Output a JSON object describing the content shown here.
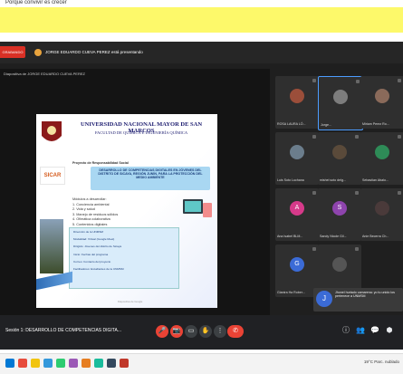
{
  "banner": {
    "text": "Porque convivir es crecer"
  },
  "presentation": {
    "rec_label": "GRABANDO",
    "presenter_text": "JORGE EDUARDO CUEVA PEREZ está presentando",
    "slide_header": "Diapositiva de JORGE EDUARDO CUEVA PEREZ",
    "slide": {
      "university": "UNIVERSIDAD NACIONAL MAYOR DE SAN MARCOS",
      "faculty": "FACULTAD DE QUÍMICA E INGENIERÍA QUÍMICA",
      "logo_text": "SICAR",
      "project_label": "Proyecto de Responsabilidad Social",
      "project_title": "DESARROLLO DE COMPETENCIAS DIGITALES EN JÓVENES DEL DISTRITO DE SICAYA, REGIÓN JUNÍN, PARA LA PROTECCIÓN DEL MEDIO AMBIENTE",
      "modules_title": "Módulos a desarrollar:",
      "modules": [
        "1. Conciencia ambiental",
        "2. Vida y salud",
        "3. Manejo de residuos sólidos",
        "4. Ofimática colaborativa",
        "5. Contenidos digitales"
      ],
      "info_lines": [
        "Dirección de la UNMSM",
        "Modalidad: Virtual (Google Meet)",
        "Dirigido: Jóvenes del distrito de Sicaya",
        "Inicio: Fechas del programa",
        "Correo: Contacto del proyecto",
        "Facilitadores: Estudiantes de la UNMSM"
      ],
      "footer": "Diapositiva de Google"
    }
  },
  "participants": [
    {
      "name": "ROSA LAURA LÓ...",
      "initial": "",
      "color": "#9b4e3a"
    },
    {
      "name": "Jorge...",
      "initial": "",
      "color": "#7d7d7d"
    },
    {
      "name": "Miriam Perez Ro...",
      "initial": "",
      "color": "#8a6a5a"
    },
    {
      "name": "Luis Soto Luchana",
      "initial": "",
      "color": "#6b7d8c"
    },
    {
      "name": "mishel soto delg...",
      "initial": "",
      "color": "#5a4a3a"
    },
    {
      "name": "Sebastian Abalo...",
      "initial": "",
      "color": "#2e8b57"
    },
    {
      "name": "Ana Isabel BLM...",
      "initial": "A",
      "color": "#d63a8a"
    },
    {
      "name": "Sandy Nicole Gil...",
      "initial": "S",
      "color": "#8e44ad"
    },
    {
      "name": "Anie Becerra Ch...",
      "initial": "",
      "color": "#4a3a3a"
    },
    {
      "name": "Gianira Ha Rober...",
      "initial": "G",
      "color": "#3b6bd6"
    },
    {
      "name": "Lily..",
      "initial": "",
      "color": "#555555"
    }
  ],
  "chat_popup": {
    "initial": "J",
    "text": "Jhonel hurtado camarena: yo tu unido los pertenece a UNMSM"
  },
  "controls": {
    "session_text": "Sesión 1: DESARROLLO DE COMPETENCIAS DIGITA..."
  },
  "taskbar": {
    "tray_text": "19°C Parc. nublado"
  }
}
